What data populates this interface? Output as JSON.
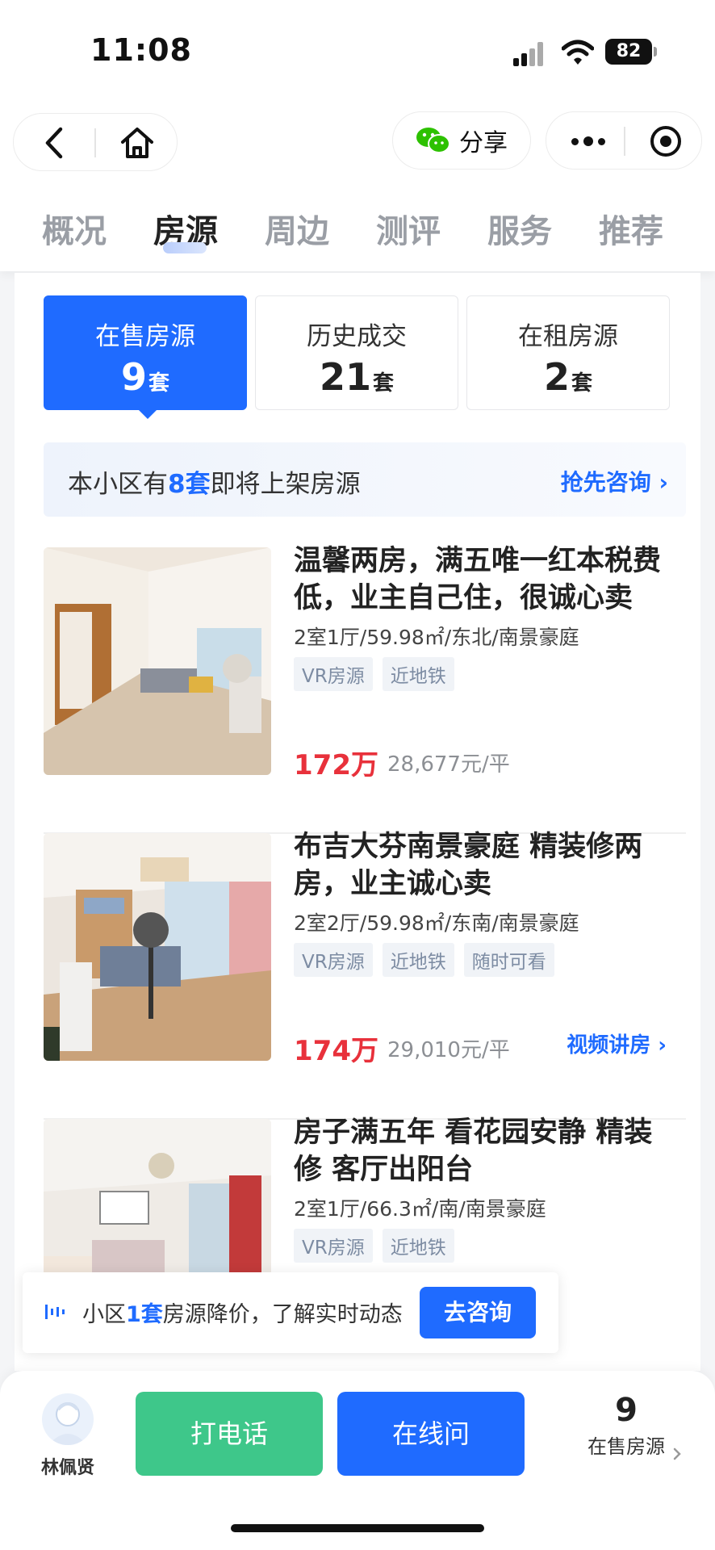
{
  "status_bar": {
    "time": "11:08",
    "battery": "82"
  },
  "nav": {
    "share_label": "分享"
  },
  "tabs": [
    {
      "label": "概况"
    },
    {
      "label": "房源"
    },
    {
      "label": "周边"
    },
    {
      "label": "测评"
    },
    {
      "label": "服务"
    },
    {
      "label": "推荐"
    }
  ],
  "active_tab": "房源",
  "segments": [
    {
      "title": "在售房源",
      "count": "9",
      "unit": "套"
    },
    {
      "title": "历史成交",
      "count": "21",
      "unit": "套"
    },
    {
      "title": "在租房源",
      "count": "2",
      "unit": "套"
    }
  ],
  "banner": {
    "prefix": "本小区有",
    "highlight": "8套",
    "suffix": "即将上架房源",
    "link": "抢先咨询"
  },
  "listings": [
    {
      "title": "温馨两房，满五唯一红本税费低，业主自己住，很诚心卖",
      "meta": "2室1厅/59.98㎡/东北/南景豪庭",
      "tags": [
        "VR房源",
        "近地铁"
      ],
      "price": "172万",
      "unit_price": "28,677元/平",
      "video": ""
    },
    {
      "title": "布吉大芬南景豪庭 精装修两房，业主诚心卖",
      "meta": "2室2厅/59.98㎡/东南/南景豪庭",
      "tags": [
        "VR房源",
        "近地铁",
        "随时可看"
      ],
      "price": "174万",
      "unit_price": "29,010元/平",
      "video": "视频讲房"
    },
    {
      "title": "房子满五年 看花园安静 精装修 客厅出阳台",
      "meta": "2室1厅/66.3㎡/南/南景豪庭",
      "tags": [
        "VR房源",
        "近地铁"
      ],
      "price": "",
      "unit_price": "",
      "video": ""
    }
  ],
  "float_tip": {
    "prefix": "小区",
    "highlight": "1套",
    "suffix": "房源降价，了解实时动态",
    "button": "去咨询"
  },
  "bottom": {
    "agent_name": "林佩贤",
    "call_label": "打电话",
    "chat_label": "在线问",
    "sale_count": "9",
    "sale_label": "在售房源"
  },
  "colors": {
    "brand_blue": "#1f6bff",
    "price_red": "#e8313b",
    "call_green": "#3ec78a"
  }
}
